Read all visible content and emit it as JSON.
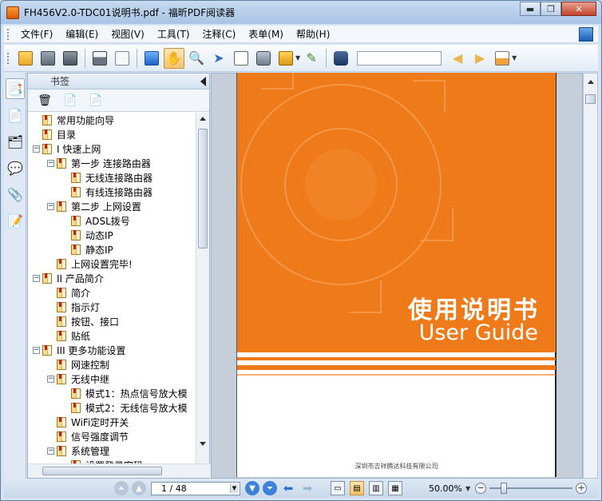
{
  "window": {
    "title": "FH456V2.0-TDC01说明书.pdf - 福昕PDF阅读器",
    "minimize": "▬",
    "maximize": "❐",
    "close": "✕"
  },
  "menu": {
    "items": [
      "文件(F)",
      "编辑(E)",
      "视图(V)",
      "工具(T)",
      "注释(C)",
      "表单(M)",
      "帮助(H)"
    ]
  },
  "toolbar": {
    "buttons": [
      "open-folder",
      "save",
      "save-as",
      "print",
      "email",
      "fullscreen",
      "hand-tool",
      "zoom-glass",
      "select-arrow",
      "typewriter",
      "snapshot",
      "rms",
      "sign-pen",
      "find-binoculars"
    ],
    "active": "hand-tool",
    "search_value": ""
  },
  "bookmarks": {
    "header": "书签",
    "items": [
      {
        "label": "常用功能向导",
        "level": 0,
        "expander": ""
      },
      {
        "label": "目录",
        "level": 0,
        "expander": ""
      },
      {
        "label": "I 快速上网",
        "level": 0,
        "expander": "−"
      },
      {
        "label": "第一步 连接路由器",
        "level": 1,
        "expander": "−"
      },
      {
        "label": "无线连接路由器",
        "level": 2,
        "expander": ""
      },
      {
        "label": "有线连接路由器",
        "level": 2,
        "expander": ""
      },
      {
        "label": "第二步 上网设置",
        "level": 1,
        "expander": "−"
      },
      {
        "label": "ADSL拨号",
        "level": 2,
        "expander": ""
      },
      {
        "label": "动态IP",
        "level": 2,
        "expander": ""
      },
      {
        "label": "静态IP",
        "level": 2,
        "expander": ""
      },
      {
        "label": "上网设置完毕!",
        "level": 1,
        "expander": ""
      },
      {
        "label": "II 产品简介",
        "level": 0,
        "expander": "−"
      },
      {
        "label": "简介",
        "level": 1,
        "expander": ""
      },
      {
        "label": "指示灯",
        "level": 1,
        "expander": ""
      },
      {
        "label": "按钮、接口",
        "level": 1,
        "expander": ""
      },
      {
        "label": "贴纸",
        "level": 1,
        "expander": ""
      },
      {
        "label": "III 更多功能设置",
        "level": 0,
        "expander": "−"
      },
      {
        "label": "网速控制",
        "level": 1,
        "expander": ""
      },
      {
        "label": "无线中继",
        "level": 1,
        "expander": "−"
      },
      {
        "label": "模式1：热点信号放大模",
        "level": 2,
        "expander": ""
      },
      {
        "label": "模式2：无线信号放大模",
        "level": 2,
        "expander": ""
      },
      {
        "label": "WiFi定时开关",
        "level": 1,
        "expander": ""
      },
      {
        "label": "信号强度调节",
        "level": 1,
        "expander": ""
      },
      {
        "label": "系统管理",
        "level": 1,
        "expander": "−"
      },
      {
        "label": "设置登录密码",
        "level": 2,
        "expander": ""
      }
    ]
  },
  "document": {
    "cover_title_cn": "使用说明书",
    "cover_title_en": "User Guide",
    "company": "深圳市吉祥腾达科技有限公司",
    "accent_color": "#ef7a1a"
  },
  "status": {
    "page_display": "1 / 48",
    "zoom": "50.00%",
    "zoom_out": "−",
    "zoom_in": "+"
  }
}
